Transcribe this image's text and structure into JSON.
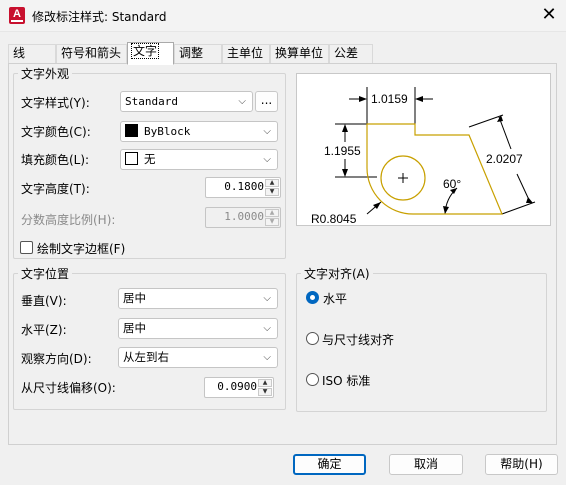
{
  "window": {
    "title": "修改标注样式: Standard",
    "app_icon_letter": "A"
  },
  "tabs": [
    {
      "label": "线",
      "active": false
    },
    {
      "label": "符号和箭头",
      "active": false
    },
    {
      "label": "文字",
      "active": true
    },
    {
      "label": "调整",
      "active": false
    },
    {
      "label": "主单位",
      "active": false
    },
    {
      "label": "换算单位",
      "active": false
    },
    {
      "label": "公差",
      "active": false
    }
  ],
  "text_appearance": {
    "group_title": "文字外观",
    "text_style": {
      "label": "文字样式(Y):",
      "value": "Standard",
      "browse_label": "..."
    },
    "text_color": {
      "label": "文字颜色(C):",
      "value": "ByBlock",
      "swatch": "#000000"
    },
    "fill_color": {
      "label": "填充颜色(L):",
      "value": "无",
      "swatch": "#ffffff"
    },
    "text_height": {
      "label": "文字高度(T):",
      "value": "0.1800"
    },
    "fraction_scale": {
      "label": "分数高度比例(H):",
      "value": "1.0000",
      "disabled": true
    },
    "draw_frame": {
      "label": "绘制文字边框(F)",
      "checked": false
    }
  },
  "text_placement": {
    "group_title": "文字位置",
    "vertical": {
      "label": "垂直(V):",
      "value": "居中"
    },
    "horizontal": {
      "label": "水平(Z):",
      "value": "居中"
    },
    "view_direction": {
      "label": "观察方向(D):",
      "value": "从左到右"
    },
    "offset": {
      "label": "从尺寸线偏移(O):",
      "value": "0.0900"
    }
  },
  "text_alignment": {
    "group_title": "文字对齐(A)",
    "options": [
      {
        "label": "水平",
        "selected": true
      },
      {
        "label": "与尺寸线对齐",
        "selected": false
      },
      {
        "label": "ISO 标准",
        "selected": false
      }
    ]
  },
  "preview": {
    "dim_top": "1.0159",
    "dim_left": "1.1955",
    "dim_right": "2.0207",
    "angle": "60°",
    "radius": "R0.8045",
    "line_color": "#c8a000"
  },
  "buttons": {
    "ok": "确定",
    "cancel": "取消",
    "help": "帮助(H)"
  },
  "colors": {
    "accent": "#0067c0",
    "app_icon": "#c8102e"
  }
}
